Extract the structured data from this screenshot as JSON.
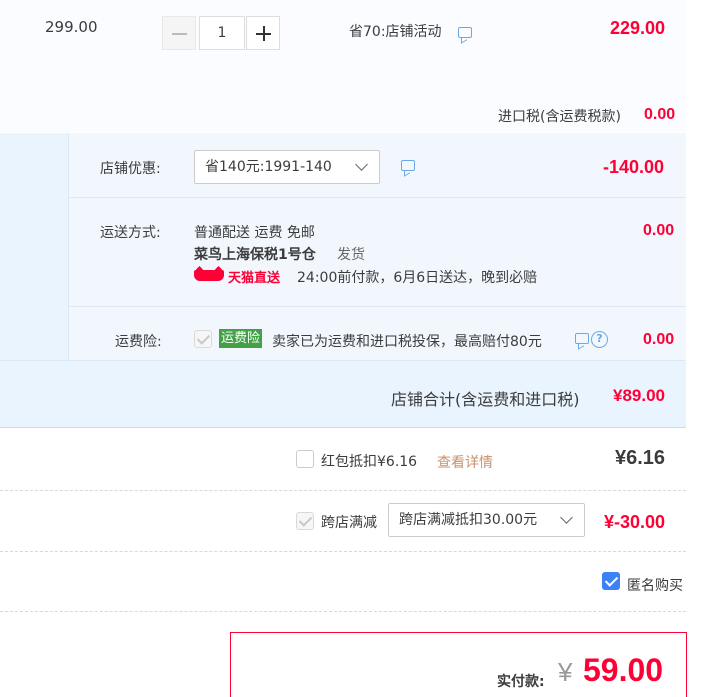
{
  "item": {
    "unit_price": "299.00",
    "quantity": "1",
    "minus": "—",
    "plus": "+",
    "promo": "省70:店铺活动",
    "subtotal": "229.00",
    "tax_label": "进口税(含运费税款)",
    "tax_value": "0.00"
  },
  "shop": {
    "discount_label": "店铺优惠:",
    "discount_select": "省140元:1991-140",
    "discount_value": "-140.00",
    "shipping_label": "运送方式:",
    "shipping_method": "普通配送 运费 免邮",
    "warehouse": "菜鸟上海保税1号仓",
    "ship_action": "发货",
    "tmall_badge": "天猫直送",
    "delivery_note": "24:00前付款，6月6日送达，晚到必赔",
    "shipping_value": "0.00",
    "insurance_label": "运费险:",
    "insurance_badge": "运费险",
    "insurance_text": "卖家已为运费和进口税投保，最高赔付80元",
    "insurance_value": "0.00",
    "total_label": "店铺合计(含运费和进口税)",
    "total_value": "¥89.00"
  },
  "redpacket": {
    "label": "红包抵扣¥6.16",
    "link": "查看详情",
    "value": "¥6.16"
  },
  "crossstore": {
    "label": "跨店满减",
    "select": "跨店满减抵扣30.00元",
    "value": "¥-30.00"
  },
  "anonymous": {
    "label": "匿名购买"
  },
  "payment": {
    "label": "实付款:",
    "currency": "¥",
    "amount": "59.00"
  },
  "colors": {
    "accent_red": "#ff0036",
    "link_orange": "#c8926b",
    "tmall_red": "#ff0036",
    "insurance_green": "#43a047"
  }
}
